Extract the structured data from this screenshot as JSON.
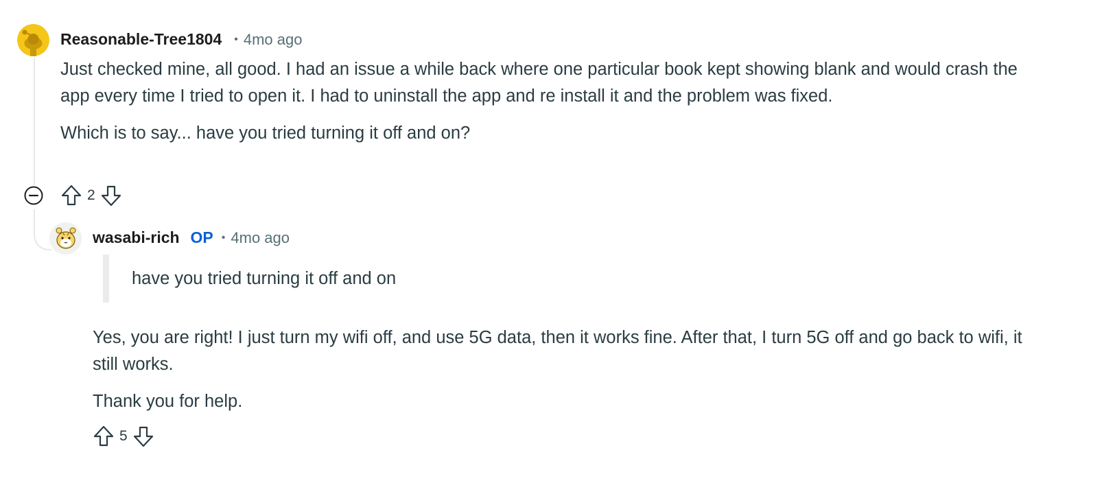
{
  "comments": [
    {
      "author": "Reasonable-Tree1804",
      "dot": "•",
      "time": "4mo ago",
      "paragraphs": [
        "Just checked mine, all good. I had an issue a while back where one particular book kept showing blank and would crash the app every time I tried to open it. I had to uninstall the app and re install it and the problem was fixed.",
        "Which is to say... have you tried turning it off and on?"
      ],
      "score": "2"
    },
    {
      "author": "wasabi-rich",
      "badge": "OP",
      "dot": "•",
      "time": "4mo ago",
      "quote": "have you tried turning it off and on",
      "paragraphs": [
        "Yes, you are right! I just turn my wifi off, and use 5G data, then it works fine. After that, I turn 5G off and go back to wifi, it still works.",
        "Thank you for help."
      ],
      "score": "5"
    }
  ],
  "icons": {
    "collapse": "collapse-thread-icon",
    "upvote": "upvote-arrow-icon",
    "downvote": "downvote-arrow-icon",
    "avatar_1": "snoo-avatar",
    "avatar_2": "tiger-avatar"
  },
  "colors": {
    "author": "#1c1c1c",
    "meta": "#576f76",
    "body": "#2a3c42",
    "op_badge": "#0a5fd6",
    "thread_line": "#e5e7eb",
    "avatar_1_bg": "#f5c518"
  }
}
